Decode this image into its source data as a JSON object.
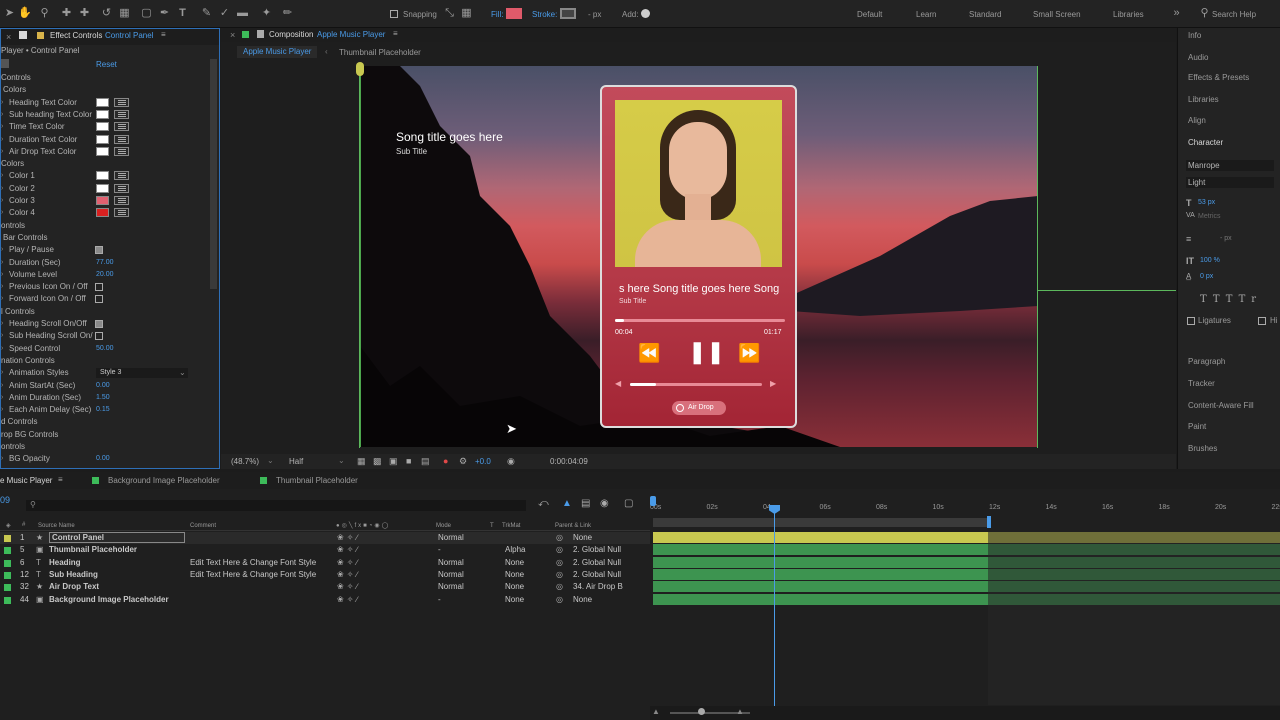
{
  "toolbar": {
    "snapping": "Snapping",
    "fill": "Fill:",
    "fill_color": "#e05a6a",
    "stroke": "Stroke:",
    "px": "- px",
    "add": "Add:"
  },
  "workspaces": [
    "Default",
    "Learn",
    "Standard",
    "Small Screen",
    "Libraries"
  ],
  "search_help": "Search Help",
  "effect_controls": {
    "tab_title": "Effect Controls",
    "tab_layer": "Control Panel",
    "sub_title": "Player • Control Panel",
    "reset": "Reset",
    "rows": [
      {
        "label": "Controls",
        "indent": 0
      },
      {
        "label": "Colors",
        "indent": 1
      },
      {
        "label": "Heading Text Color",
        "indent": 2,
        "swatch": "#ffffff"
      },
      {
        "label": "Sub heading Text Color",
        "indent": 2,
        "swatch": "#ffffff"
      },
      {
        "label": "Time Text Color",
        "indent": 2,
        "swatch": "#ffffff"
      },
      {
        "label": "Duration Text Color",
        "indent": 2,
        "swatch": "#ffffff"
      },
      {
        "label": "Air Drop Text Color",
        "indent": 2,
        "swatch": "#ffffff"
      },
      {
        "label": "Colors",
        "indent": 0
      },
      {
        "label": "Color 1",
        "indent": 2,
        "swatch": "#ffffff"
      },
      {
        "label": "Color 2",
        "indent": 2,
        "swatch": "#ffffff"
      },
      {
        "label": "Color 3",
        "indent": 2,
        "swatch": "#e06070"
      },
      {
        "label": "Color 4",
        "indent": 2,
        "swatch": "#d82020"
      },
      {
        "label": "ontrols",
        "indent": 0
      },
      {
        "label": "Bar Controls",
        "indent": 1
      },
      {
        "label": "Play / Pause",
        "indent": 2,
        "check": true
      },
      {
        "label": "Duration (Sec)",
        "indent": 2,
        "value": "77.00"
      },
      {
        "label": "Volume Level",
        "indent": 2,
        "value": "20.00"
      },
      {
        "label": "Previous Icon On / Off",
        "indent": 2,
        "check": false
      },
      {
        "label": "Forward Icon On / Off",
        "indent": 2,
        "check": false
      },
      {
        "label": "l Controls",
        "indent": 0
      },
      {
        "label": "Heading Scroll On/Off",
        "indent": 2,
        "check": true
      },
      {
        "label": "Sub Heading Scroll On/",
        "indent": 2,
        "check": false
      },
      {
        "label": "Speed Control",
        "indent": 2,
        "value": "50.00"
      },
      {
        "label": "nation Controls",
        "indent": 0
      },
      {
        "label": "Animation Styles",
        "indent": 2,
        "dropdown": "Style 3"
      },
      {
        "label": "Anim StartAt (Sec)",
        "indent": 2,
        "value": "0.00"
      },
      {
        "label": "Anim Duration (Sec)",
        "indent": 2,
        "value": "1.50"
      },
      {
        "label": "Each Anim Delay (Sec)",
        "indent": 2,
        "value": "0.15"
      },
      {
        "label": "d Controls",
        "indent": 0
      },
      {
        "label": "rop BG Controls",
        "indent": 0
      },
      {
        "label": "ontrols",
        "indent": 0
      },
      {
        "label": "BG Opacity",
        "indent": 2,
        "value": "0.00"
      }
    ]
  },
  "composition": {
    "tab_title": "Composition",
    "tab_name": "Apple Music Player",
    "breadcrumb_1": "Apple Music Player",
    "breadcrumb_2": "Thumbnail Placeholder"
  },
  "viewer": {
    "song_title": "Song title goes here",
    "sub_title": "Sub Title",
    "card_title": "s here Song title goes here Song",
    "card_sub": "Sub Title",
    "time_start": "00:04",
    "time_end": "01:17",
    "air_drop": "Air Drop",
    "progress": 0.05,
    "volume": 0.2
  },
  "viewer_footer": {
    "zoom": "(48.7%)",
    "resolution": "Half",
    "time": "0:00:04:09",
    "plus": "+0.0"
  },
  "right_panel": [
    "Info",
    "Audio",
    "Effects & Presets",
    "Libraries",
    "Align",
    "Character"
  ],
  "character": {
    "font": "Manrope",
    "style": "Light",
    "size": "53 px",
    "metrics": "Metrics",
    "px1": "- px",
    "scale": "100 %",
    "px2": "0 px",
    "ligatures": "Ligatures",
    "hi": "Hi"
  },
  "right_panel_lower": [
    "Paragraph",
    "Tracker",
    "Content-Aware Fill",
    "Paint",
    "Brushes"
  ],
  "timeline": {
    "tabs": [
      "e Music Player",
      "Background Image Placeholder",
      "Thumbnail Placeholder"
    ],
    "timecode": "09",
    "headers": {
      "source": "Source Name",
      "comment": "Comment",
      "mode": "Mode",
      "t": "T",
      "trkmat": "TrkMat",
      "parent": "Parent & Link"
    },
    "ruler": [
      "00s",
      "02s",
      "04s",
      "06s",
      "08s",
      "10s",
      "12s",
      "14s",
      "16s",
      "18s",
      "20s",
      "22s"
    ],
    "layers": [
      {
        "num": "1",
        "name": "Control Panel",
        "comment": "",
        "mode": "Normal",
        "trkmat": "",
        "parent": "None",
        "bar": "#c8c850"
      },
      {
        "num": "5",
        "name": "Thumbnail Placeholder",
        "comment": "",
        "mode": "-",
        "trkmat": "Alpha",
        "parent": "2. Global Null",
        "bar": "#3d9450"
      },
      {
        "num": "6",
        "name": "Heading",
        "comment": "Edit Text Here & Change Font Style",
        "mode": "Normal",
        "trkmat": "None",
        "parent": "2. Global Null",
        "bar": "#3d9450"
      },
      {
        "num": "12",
        "name": "Sub Heading",
        "comment": "Edit Text Here & Change Font Style",
        "mode": "Normal",
        "trkmat": "None",
        "parent": "2. Global Null",
        "bar": "#3d9450"
      },
      {
        "num": "32",
        "name": "Air Drop Text",
        "comment": "",
        "mode": "Normal",
        "trkmat": "None",
        "parent": "34. Air Drop B",
        "bar": "#3d9450"
      },
      {
        "num": "44",
        "name": "Background Image Placeholder",
        "comment": "",
        "mode": "-",
        "trkmat": "None",
        "parent": "None",
        "bar": "#3d9450"
      }
    ]
  }
}
